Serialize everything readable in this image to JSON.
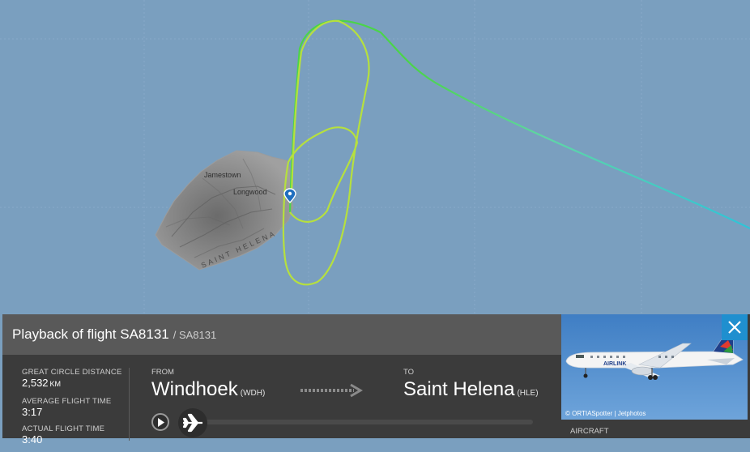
{
  "map": {
    "places": [
      "Jamestown",
      "Longwood"
    ],
    "island_label": "SAINT HELENA"
  },
  "panel": {
    "title": "Playback of flight SA8131",
    "subtitle": "/ SA8131",
    "stats": [
      {
        "label": "GREAT CIRCLE DISTANCE",
        "value": "2,532",
        "unit": "KM"
      },
      {
        "label": "AVERAGE FLIGHT TIME",
        "value": "3:17",
        "unit": ""
      },
      {
        "label": "ACTUAL FLIGHT TIME",
        "value": "3:40",
        "unit": ""
      }
    ],
    "from": {
      "label": "FROM",
      "name": "Windhoek",
      "code": "(WDH)"
    },
    "to": {
      "label": "TO",
      "name": "Saint Helena",
      "code": "(HLE)"
    },
    "playback_progress": 0.0
  },
  "aircraft": {
    "photo_credit": "© ORTIASpotter | Jetphotos",
    "label": "AIRCRAFT",
    "livery_text": "AIRLINK"
  },
  "colors": {
    "sea": "#7a9fbf",
    "track_start": "#2ec4d8",
    "track_end": "#c8e63c",
    "accent": "#1f8fcf"
  },
  "icons": [
    "location-pin-icon",
    "play-icon",
    "airplane-icon",
    "arrow-right-icon",
    "close-icon"
  ]
}
